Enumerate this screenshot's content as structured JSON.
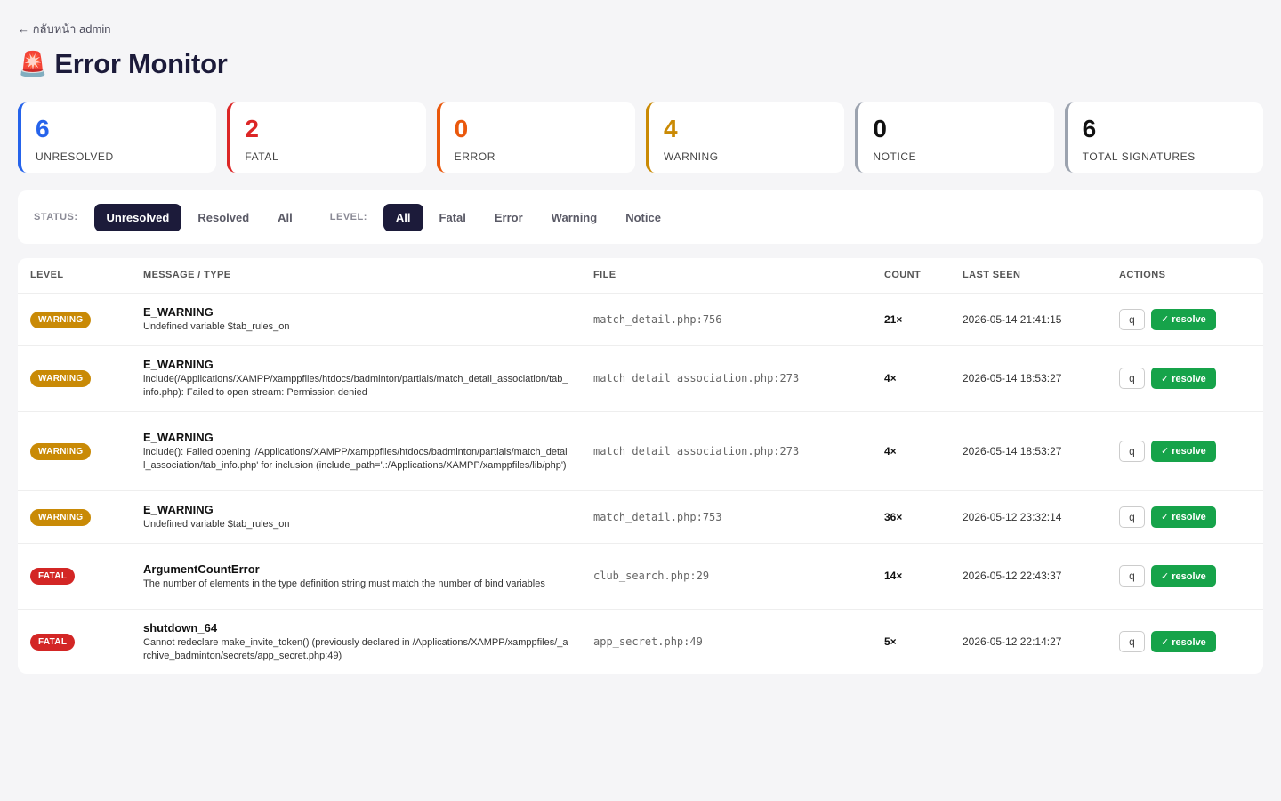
{
  "nav": {
    "back_label": "← กลับหน้า admin"
  },
  "page": {
    "title_icon": "🚨",
    "title": "Error Monitor"
  },
  "stats": [
    {
      "value": "6",
      "label": "UNRESOLVED",
      "color": "#2563eb"
    },
    {
      "value": "2",
      "label": "FATAL",
      "color": "#dc2626"
    },
    {
      "value": "0",
      "label": "ERROR",
      "color": "#ea580c"
    },
    {
      "value": "4",
      "label": "WARNING",
      "color": "#ca8a04"
    },
    {
      "value": "0",
      "label": "NOTICE",
      "color": "#9ca3af"
    },
    {
      "value": "6",
      "label": "TOTAL SIGNATURES",
      "color": "#9ca3af"
    }
  ],
  "filters": {
    "status_label": "STATUS:",
    "status_options": [
      "Unresolved",
      "Resolved",
      "All"
    ],
    "status_selected": "Unresolved",
    "level_label": "LEVEL:",
    "level_options": [
      "All",
      "Fatal",
      "Error",
      "Warning",
      "Notice"
    ],
    "level_selected": "All"
  },
  "table": {
    "headers": [
      "LEVEL",
      "MESSAGE / TYPE",
      "FILE",
      "COUNT",
      "LAST SEEN",
      "ACTIONS"
    ],
    "q_label": "q",
    "resolve_label": "✓ resolve",
    "rows": [
      {
        "level": "WARNING",
        "type": "E_WARNING",
        "message": "Undefined variable $tab_rules_on",
        "file": "match_detail.php:756",
        "count": "21×",
        "last_seen": "2026-05-14 21:41:15"
      },
      {
        "level": "WARNING",
        "type": "E_WARNING",
        "message": "include(/Applications/XAMPP/xamppfiles/htdocs/badminton/partials/match_detail_association/tab_info.php): Failed to open stream: Permission denied",
        "file": "match_detail_association.php:273",
        "count": "4×",
        "last_seen": "2026-05-14 18:53:27"
      },
      {
        "level": "WARNING",
        "type": "E_WARNING",
        "message": "include(): Failed opening '/Applications/XAMPP/xamppfiles/htdocs/badminton/partials/match_detail_association/tab_info.php' for inclusion (include_path='.:/Applications/XAMPP/xamppfiles/lib/php')",
        "file": "match_detail_association.php:273",
        "count": "4×",
        "last_seen": "2026-05-14 18:53:27"
      },
      {
        "level": "WARNING",
        "type": "E_WARNING",
        "message": "Undefined variable $tab_rules_on",
        "file": "match_detail.php:753",
        "count": "36×",
        "last_seen": "2026-05-12 23:32:14"
      },
      {
        "level": "FATAL",
        "type": "ArgumentCountError",
        "message": "The number of elements in the type definition string must match the number of bind variables",
        "file": "club_search.php:29",
        "count": "14×",
        "last_seen": "2026-05-12 22:43:37"
      },
      {
        "level": "FATAL",
        "type": "shutdown_64",
        "message": "Cannot redeclare make_invite_token() (previously declared in /Applications/XAMPP/xamppfiles/_archive_badminton/secrets/app_secret.php:49)",
        "file": "app_secret.php:49",
        "count": "5×",
        "last_seen": "2026-05-12 22:14:27"
      }
    ]
  }
}
